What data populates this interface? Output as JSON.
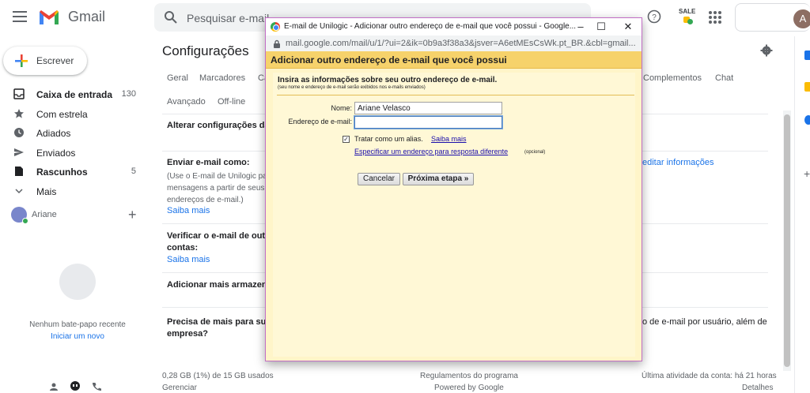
{
  "gmail": {
    "app_name": "Gmail",
    "search_placeholder": "Pesquisar e-mail",
    "account_initial": "A",
    "sale_badge": "SALE"
  },
  "sidebar": {
    "compose_label": "Escrever",
    "items": [
      {
        "label": "Caixa de entrada",
        "count": "130",
        "icon": "inbox-icon",
        "bold": true
      },
      {
        "label": "Com estrela",
        "count": "",
        "icon": "star-icon",
        "bold": false
      },
      {
        "label": "Adiados",
        "count": "",
        "icon": "clock-icon",
        "bold": false
      },
      {
        "label": "Enviados",
        "count": "",
        "icon": "send-icon",
        "bold": false
      },
      {
        "label": "Rascunhos",
        "count": "5",
        "icon": "draft-icon",
        "bold": true
      },
      {
        "label": "Mais",
        "count": "",
        "icon": "chevron-down-icon",
        "bold": false
      }
    ],
    "user_name": "Ariane",
    "chat_empty": "Nenhum bate-papo recente",
    "chat_start": "Iniciar um novo"
  },
  "settings": {
    "title": "Configurações",
    "tabs_row1": [
      "Geral",
      "Marcadores",
      "Ca"
    ],
    "tabs_row1_right": [
      "Complementos",
      "Chat"
    ],
    "tabs_row2": [
      "Avançado",
      "Off-line"
    ],
    "section_change": "Alterar configurações da",
    "send_as_title": "Enviar e-mail como:",
    "send_as_desc_1": "(Use o E-mail de Unilogic par",
    "send_as_desc_2": "mensagens a partir de seus c",
    "send_as_desc_3": "endereços de e-mail.)",
    "learn_more": "Saiba mais",
    "edit_info": "editar informações",
    "verify_title_1": "Verificar o e-mail de outr",
    "verify_title_2": "contas:",
    "storage_title": "Adicionar mais armazena",
    "need_more_1": "Precisa de mais para sua",
    "need_more_2": "empresa?",
    "need_more_right": "o de e-mail por usuário, além de",
    "footer_usage": "0,28 GB (1%) de 15 GB usados",
    "footer_manage": "Gerenciar",
    "footer_policies": "Regulamentos do programa",
    "footer_powered": "Powered by Google",
    "footer_activity": "Última atividade da conta: há 21 horas",
    "footer_details": "Detalhes"
  },
  "popup": {
    "window_title": "E-mail de Unilogic - Adicionar outro endereço de e-mail que você possui - Google...",
    "url": "mail.google.com/mail/u/1/?ui=2&ik=0b9a3f38a3&jsver=A6etMEsCsWk.pt_BR.&cbl=gmail...",
    "header": "Adicionar outro endereço de e-mail que você possui",
    "heading": "Insira as informações sobre seu outro endereço de e-mail.",
    "subheading": "(seu nome e endereço de e-mail serão exibidos nos e-mails enviados)",
    "name_label": "Nome:",
    "name_value": "Ariane Velasco",
    "email_label": "Endereço de e-mail:",
    "email_value": "",
    "alias_label": "Tratar como um alias.",
    "alias_learn_more": "Saiba mais",
    "reply_to_link": "Especificar um endereço para resposta diferente",
    "optional": "(opcional)",
    "cancel_label": "Cancelar",
    "next_label": "Próxima etapa »"
  },
  "colors": {
    "popup_header": "#f6d26b",
    "popup_body": "#fff5c9",
    "link": "#1a73e8"
  }
}
